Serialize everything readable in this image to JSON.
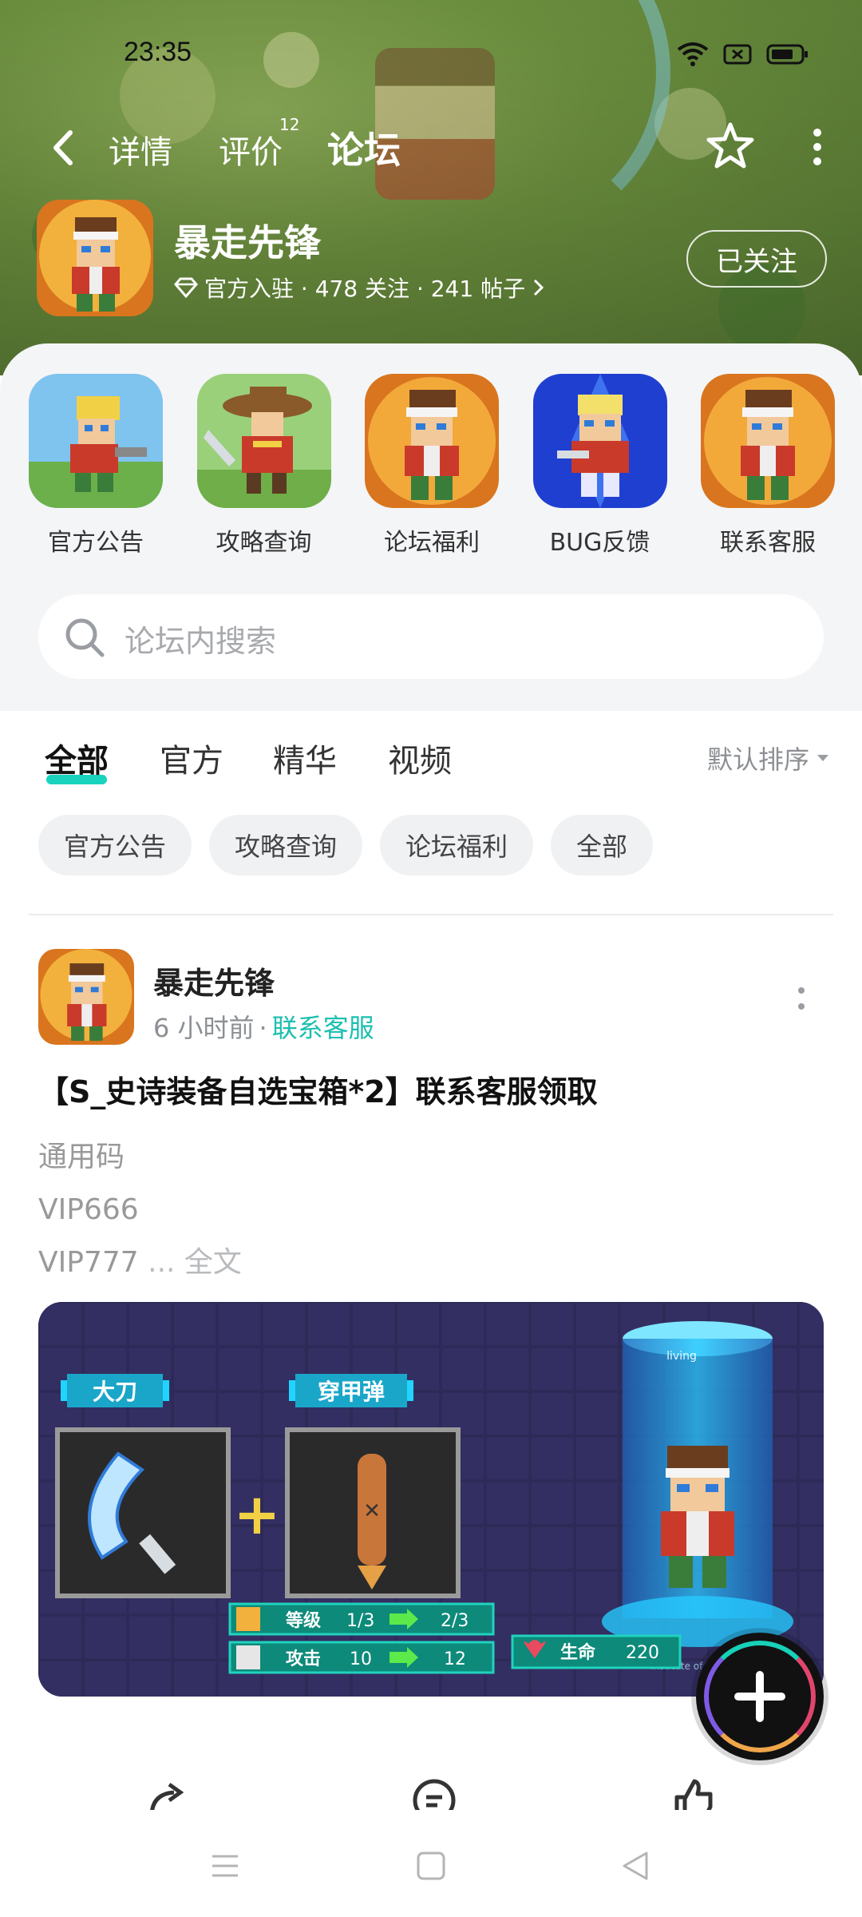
{
  "status_bar": {
    "time": "23:35"
  },
  "header": {
    "tabs": [
      {
        "label": "详情",
        "active": false
      },
      {
        "label": "评价",
        "active": false,
        "count": "12"
      },
      {
        "label": "论坛",
        "active": true
      }
    ]
  },
  "game": {
    "title": "暴走先锋",
    "meta": "官方入驻 · 478 关注 · 241 帖子",
    "follow_label": "已关注"
  },
  "shortcuts": [
    {
      "label": "官方公告"
    },
    {
      "label": "攻略查询"
    },
    {
      "label": "论坛福利"
    },
    {
      "label": "BUG反馈"
    },
    {
      "label": "联系客服"
    }
  ],
  "search": {
    "placeholder": "论坛内搜索"
  },
  "filter_tabs": [
    {
      "label": "全部",
      "active": true
    },
    {
      "label": "官方",
      "active": false
    },
    {
      "label": "精华",
      "active": false
    },
    {
      "label": "视频",
      "active": false
    }
  ],
  "sort_label": "默认排序",
  "chips": [
    "官方公告",
    "攻略查询",
    "论坛福利",
    "全部"
  ],
  "post": {
    "author": "暴走先锋",
    "time": "6 小时前",
    "separator": "·",
    "category": "联系客服",
    "title": "【S_史诗装备自选宝箱*2】联系客服领取",
    "lines": [
      "通用码",
      "VIP666",
      "VIP777"
    ],
    "ellipsis": "...",
    "more_label": "全文",
    "image": {
      "label_left": "大刀",
      "label_right": "穿甲弹",
      "plus": "+",
      "capsule_text": "living",
      "capsule_base": "Institute of Virology",
      "stats": [
        {
          "name": "等级",
          "from": "1/3",
          "to": "2/3"
        },
        {
          "name": "攻击",
          "from": "10",
          "to": "12"
        }
      ],
      "hp_label": "生命",
      "hp_value": "220"
    }
  },
  "colors": {
    "accent": "#19d3be",
    "category": "#1cbfb0",
    "panel": "#f4f5f7"
  }
}
